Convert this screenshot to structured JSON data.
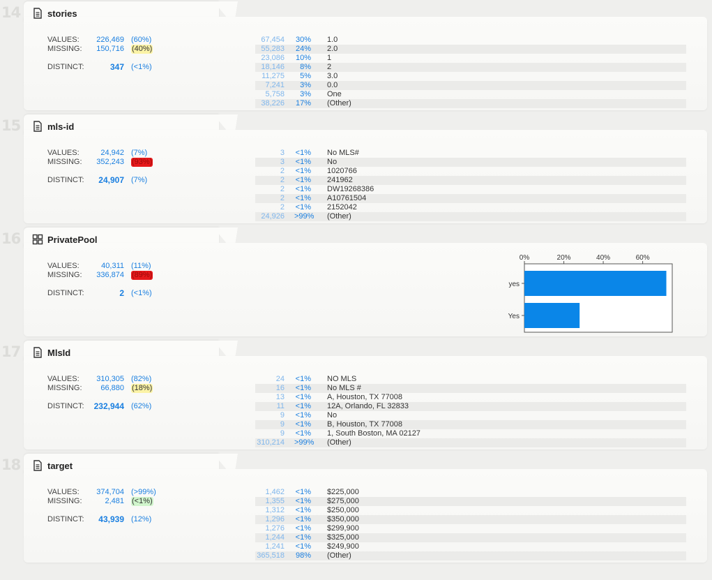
{
  "sections": [
    {
      "num": "14",
      "name": "stories",
      "icon": "document-icon",
      "values": "226,469",
      "values_pct": "(60%)",
      "missing": "150,716",
      "missing_pct": "(40%)",
      "missing_color": "yellow",
      "distinct": "347",
      "distinct_pct": "(<1%)",
      "freq": [
        {
          "count": "67,454",
          "pct": "30%",
          "value": "1.0"
        },
        {
          "count": "55,283",
          "pct": "24%",
          "value": "2.0"
        },
        {
          "count": "23,086",
          "pct": "10%",
          "value": "1"
        },
        {
          "count": "18,146",
          "pct": "8%",
          "value": "2"
        },
        {
          "count": "11,275",
          "pct": "5%",
          "value": "3.0"
        },
        {
          "count": "7,241",
          "pct": "3%",
          "value": "0.0"
        },
        {
          "count": "5,758",
          "pct": "3%",
          "value": "One"
        },
        {
          "count": "38,226",
          "pct": "17%",
          "value": "(Other)"
        }
      ]
    },
    {
      "num": "15",
      "name": "mls-id",
      "icon": "document-icon",
      "values": "24,942",
      "values_pct": "(7%)",
      "missing": "352,243",
      "missing_pct": "(93%)",
      "missing_color": "red",
      "distinct": "24,907",
      "distinct_pct": "(7%)",
      "freq": [
        {
          "count": "3",
          "pct": "<1%",
          "value": "No MLS#"
        },
        {
          "count": "3",
          "pct": "<1%",
          "value": "No"
        },
        {
          "count": "2",
          "pct": "<1%",
          "value": "1020766"
        },
        {
          "count": "2",
          "pct": "<1%",
          "value": "241962"
        },
        {
          "count": "2",
          "pct": "<1%",
          "value": "DW19268386"
        },
        {
          "count": "2",
          "pct": "<1%",
          "value": "A10761504"
        },
        {
          "count": "2",
          "pct": "<1%",
          "value": "2152042"
        },
        {
          "count": "24,926",
          "pct": ">99%",
          "value": "(Other)"
        }
      ]
    },
    {
      "num": "16",
      "name": "PrivatePool",
      "icon": "grid-icon",
      "values": "40,311",
      "values_pct": "(11%)",
      "missing": "336,874",
      "missing_pct": "(89%)",
      "missing_color": "red",
      "distinct": "2",
      "distinct_pct": "(<1%)",
      "freq": []
    },
    {
      "num": "17",
      "name": "MlsId",
      "icon": "document-icon",
      "values": "310,305",
      "values_pct": "(82%)",
      "missing": "66,880",
      "missing_pct": "(18%)",
      "missing_color": "yellow",
      "distinct": "232,944",
      "distinct_pct": "(62%)",
      "freq": [
        {
          "count": "24",
          "pct": "<1%",
          "value": "NO MLS"
        },
        {
          "count": "16",
          "pct": "<1%",
          "value": "No MLS #"
        },
        {
          "count": "13",
          "pct": "<1%",
          "value": "A, Houston, TX 77008"
        },
        {
          "count": "11",
          "pct": "<1%",
          "value": "12A, Orlando, FL 32833"
        },
        {
          "count": "9",
          "pct": "<1%",
          "value": "No"
        },
        {
          "count": "9",
          "pct": "<1%",
          "value": "B, Houston, TX 77008"
        },
        {
          "count": "9",
          "pct": "<1%",
          "value": "1, South Boston, MA 02127"
        },
        {
          "count": "310,214",
          "pct": ">99%",
          "value": "(Other)"
        }
      ]
    },
    {
      "num": "18",
      "name": "target",
      "icon": "document-icon",
      "values": "374,704",
      "values_pct": "(>99%)",
      "missing": "2,481",
      "missing_pct": "(<1%)",
      "missing_color": "green",
      "distinct": "43,939",
      "distinct_pct": "(12%)",
      "freq": [
        {
          "count": "1,462",
          "pct": "<1%",
          "value": "$225,000"
        },
        {
          "count": "1,355",
          "pct": "<1%",
          "value": "$275,000"
        },
        {
          "count": "1,312",
          "pct": "<1%",
          "value": "$250,000"
        },
        {
          "count": "1,296",
          "pct": "<1%",
          "value": "$350,000"
        },
        {
          "count": "1,276",
          "pct": "<1%",
          "value": "$299,900"
        },
        {
          "count": "1,244",
          "pct": "<1%",
          "value": "$325,000"
        },
        {
          "count": "1,241",
          "pct": "<1%",
          "value": "$249,900"
        },
        {
          "count": "365,518",
          "pct": "98%",
          "value": "(Other)"
        }
      ]
    }
  ],
  "labels": {
    "values": "VALUES:",
    "missing": "MISSING:",
    "distinct": "DISTINCT:"
  },
  "chart_data": {
    "type": "bar",
    "orientation": "horizontal",
    "categories": [
      "yes",
      "Yes"
    ],
    "values": [
      72,
      28
    ],
    "x_ticks": [
      "0%",
      "20%",
      "40%",
      "60%"
    ],
    "xlim": [
      0,
      75
    ],
    "bar_color": "#0a86e8",
    "title": "",
    "xlabel": "",
    "ylabel": ""
  },
  "colors": {
    "accent": "#1a7fe0",
    "light_accent": "#7fb6ec",
    "warning": "#fbf3a6",
    "danger": "#e6191b",
    "ok": "#d0f5cc"
  }
}
